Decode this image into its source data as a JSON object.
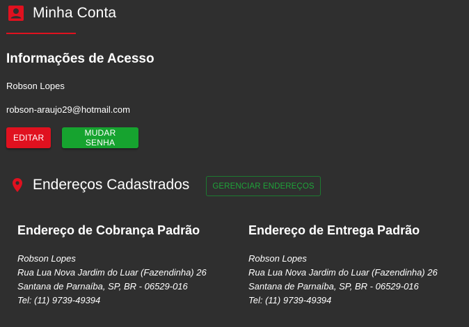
{
  "header": {
    "title": "Minha Conta",
    "icon": "account-box-icon",
    "accent_color": "#e0111f"
  },
  "access": {
    "title": "Informações de Acesso",
    "name": "Robson Lopes",
    "email": "robson-araujo29@hotmail.com",
    "edit_label": "EDITAR",
    "change_password_label": "MUDAR SENHA"
  },
  "addresses": {
    "title": "Endereços Cadastrados",
    "icon": "map-pin-icon",
    "manage_label": "GERENCIAR ENDEREÇOS",
    "billing": {
      "title": "Endereço de Cobrança Padrão",
      "name": "Robson Lopes",
      "street": "Rua Lua Nova Jardim do Luar (Fazendinha) 26",
      "city": "Santana de Parnaíba, SP, BR - 06529-016",
      "phone": "Tel: (11) 9739-49394"
    },
    "shipping": {
      "title": "Endereço de Entrega Padrão",
      "name": "Robson Lopes",
      "street": "Rua Lua Nova Jardim do Luar (Fazendinha) 26",
      "city": "Santana de Parnaíba, SP, BR - 06529-016",
      "phone": "Tel: (11) 9739-49394"
    }
  },
  "colors": {
    "background": "#2f2f2f",
    "red": "#e0111f",
    "green": "#16a32f"
  }
}
